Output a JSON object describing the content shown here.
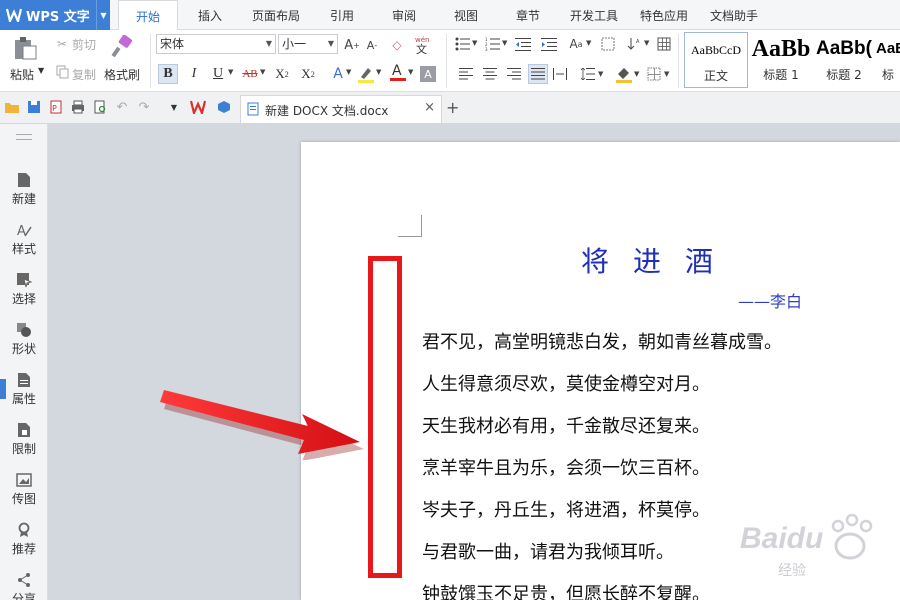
{
  "app": {
    "name": "WPS 文字"
  },
  "menu": {
    "tabs": [
      "开始",
      "插入",
      "页面布局",
      "引用",
      "审阅",
      "视图",
      "章节",
      "开发工具",
      "特色应用",
      "文档助手"
    ],
    "active": "开始"
  },
  "ribbon": {
    "paste": "粘贴",
    "cut": "剪切",
    "copy": "复制",
    "format_painter": "格式刷",
    "font_name": "宋体",
    "font_size": "小一",
    "styles": [
      {
        "preview": "AaBbCcD",
        "label": "正文"
      },
      {
        "preview": "AaBb",
        "label": "标题 1"
      },
      {
        "preview": "AaBb(",
        "label": "标题 2"
      },
      {
        "preview": "AaB",
        "label": "标"
      }
    ]
  },
  "doc_tab": {
    "title": "新建 DOCX 文档.docx"
  },
  "sidebar": {
    "items": [
      "新建",
      "样式",
      "选择",
      "形状",
      "属性",
      "限制",
      "传图",
      "推荐",
      "分享"
    ]
  },
  "document": {
    "title": "将进酒",
    "author": "——李白",
    "lines": [
      "君不见，高堂明镜悲白发，朝如青丝暮成雪。",
      "人生得意须尽欢，莫使金樽空对月。",
      "天生我材必有用，千金散尽还复来。",
      "烹羊宰牛且为乐，会须一饮三百杯。",
      "岑夫子，丹丘生，将进酒，杯莫停。",
      "与君歌一曲，请君为我倾耳听。",
      "钟鼓馔玉不足贵，但愿长醉不复醒。"
    ]
  },
  "watermark": {
    "text": "Baidu",
    "sub": "经验"
  },
  "colors": {
    "accent": "#3d7fd6",
    "title_blue": "#1f2fb8",
    "annotation_red": "#e8171c"
  }
}
